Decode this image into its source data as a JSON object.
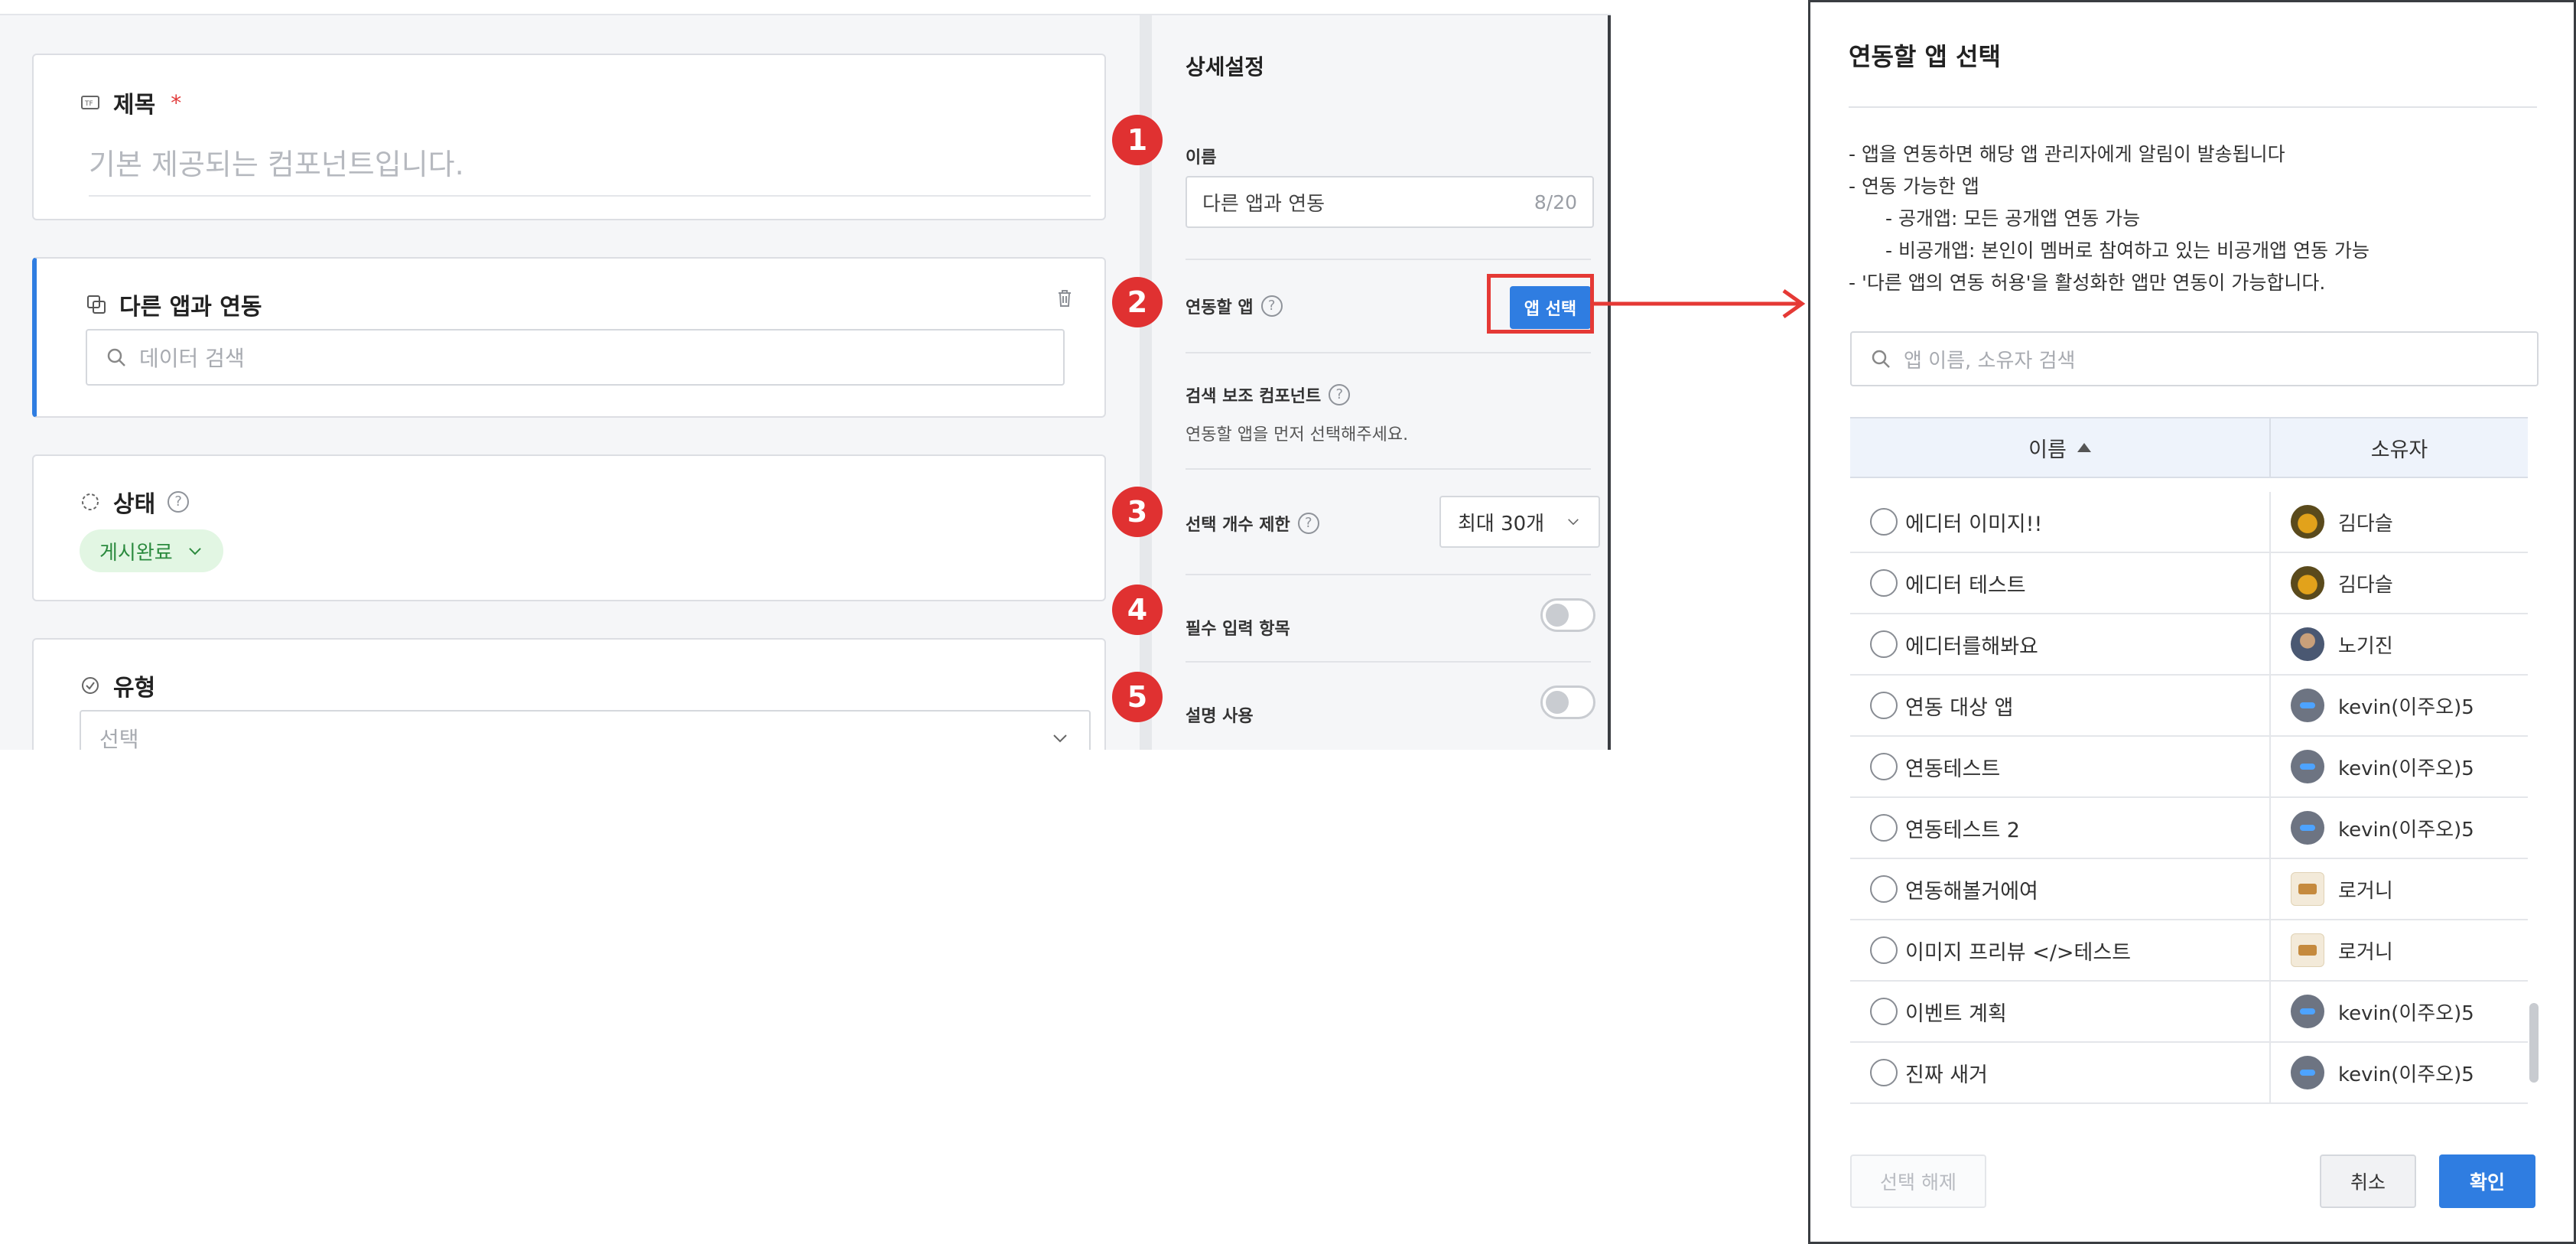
{
  "editor": {
    "title_card": {
      "label": "제목",
      "required_mark": "*",
      "placeholder": "기본 제공되는 컴포넌트입니다."
    },
    "link_card": {
      "label": "다른 앱과 연동",
      "search_placeholder": "데이터 검색"
    },
    "status_card": {
      "label": "상태",
      "value": "게시완료"
    },
    "type_card": {
      "label": "유형",
      "placeholder": "선택"
    }
  },
  "settings": {
    "heading": "상세설정",
    "name_label": "이름",
    "name_value": "다른 앱과 연동",
    "name_count": "8/20",
    "link_app_label": "연동할 앱",
    "app_select_button": "앱 선택",
    "search_aux_label": "검색 보조 컴포넌트",
    "search_aux_hint": "연동할 앱을 먼저 선택해주세요.",
    "limit_label": "선택 개수 제한",
    "limit_value": "최대 30개",
    "required_label": "필수 입력 항목",
    "required_on": false,
    "description_label": "설명 사용",
    "description_on": false,
    "help_glyph": "?"
  },
  "badges": [
    "1",
    "2",
    "3",
    "4",
    "5"
  ],
  "dialog": {
    "title": "연동할 앱 선택",
    "notes": [
      "- 앱을 연동하면 해당 앱 관리자에게 알림이 발송됩니다",
      "- 연동 가능한 앱",
      "- 공개앱: 모든 공개앱 연동 가능",
      "- 비공개앱: 본인이 멤버로 참여하고 있는 비공개앱 연동 가능",
      "- '다른 앱의 연동 허용'을 활성화한 앱만 연동이 가능합니다."
    ],
    "search_placeholder": "앱 이름, 소유자 검색",
    "col_name": "이름",
    "col_owner": "소유자",
    "rows": [
      {
        "name": "에디터 이미지!!",
        "owner": "김다슬",
        "avatar": "bird"
      },
      {
        "name": "에디터 테스트",
        "owner": "김다슬",
        "avatar": "bird"
      },
      {
        "name": "에디터를해봐요",
        "owner": "노기진",
        "avatar": "photo"
      },
      {
        "name": "연동 대상 앱",
        "owner": "kevin(이주오)5",
        "avatar": "ball"
      },
      {
        "name": "연동테스트",
        "owner": "kevin(이주오)5",
        "avatar": "ball"
      },
      {
        "name": "연동테스트 2",
        "owner": "kevin(이주오)5",
        "avatar": "ball"
      },
      {
        "name": "연동해볼거에여",
        "owner": "로거니",
        "avatar": "cookie"
      },
      {
        "name": "이미지 프리뷰 </>테스트",
        "owner": "로거니",
        "avatar": "cookie"
      },
      {
        "name": "이벤트 계획",
        "owner": "kevin(이주오)5",
        "avatar": "ball"
      },
      {
        "name": "진짜 새거",
        "owner": "kevin(이주오)5",
        "avatar": "ball"
      }
    ],
    "btn_clear": "선택 해제",
    "btn_cancel": "취소",
    "btn_ok": "확인"
  },
  "colors": {
    "accent": "#2f7de1",
    "annotation_red": "#e53935",
    "status_green": "#2b8a3e"
  }
}
